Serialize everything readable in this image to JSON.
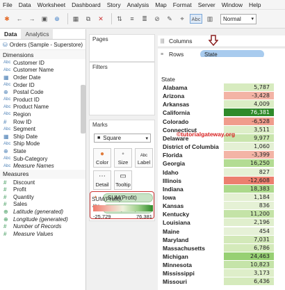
{
  "menu": [
    "File",
    "Data",
    "Worksheet",
    "Dashboard",
    "Story",
    "Analysis",
    "Map",
    "Format",
    "Server",
    "Window",
    "Help"
  ],
  "toolbar": {
    "abc_label": "Abc",
    "fit_value": "Normal"
  },
  "data_pane": {
    "tabs": [
      "Data",
      "Analytics"
    ],
    "datasource": "Orders (Sample - Superstore)",
    "dimensions_title": "Dimensions",
    "dimensions": [
      {
        "type": "Abc",
        "name": "Customer ID"
      },
      {
        "type": "Abc",
        "name": "Customer Name"
      },
      {
        "type": "cal",
        "name": "Order Date"
      },
      {
        "type": "Abc",
        "name": "Order ID"
      },
      {
        "type": "geo",
        "name": "Postal Code"
      },
      {
        "type": "Abc",
        "name": "Product ID"
      },
      {
        "type": "Abc",
        "name": "Product Name"
      },
      {
        "type": "Abc",
        "name": "Region"
      },
      {
        "type": "#",
        "name": "Row ID"
      },
      {
        "type": "Abc",
        "name": "Segment"
      },
      {
        "type": "cal",
        "name": "Ship Date"
      },
      {
        "type": "Abc",
        "name": "Ship Mode"
      },
      {
        "type": "geo",
        "name": "State"
      },
      {
        "type": "Abc",
        "name": "Sub-Category"
      },
      {
        "type": "Abc",
        "name": "Measure Names"
      }
    ],
    "measures_title": "Measures",
    "measures": [
      {
        "type": "#",
        "name": "Discount"
      },
      {
        "type": "#",
        "name": "Profit"
      },
      {
        "type": "#",
        "name": "Quantity"
      },
      {
        "type": "#",
        "name": "Sales"
      },
      {
        "type": "geo",
        "name": "Latitude (generated)"
      },
      {
        "type": "geo",
        "name": "Longitude (generated)"
      },
      {
        "type": "#",
        "name": "Number of Records"
      },
      {
        "type": "#",
        "name": "Measure Values"
      }
    ]
  },
  "pages_title": "Pages",
  "filters_title": "Filters",
  "marks": {
    "title": "Marks",
    "type": "Square",
    "buttons": [
      "Color",
      "Size",
      "Label",
      "Detail",
      "Tooltip"
    ],
    "label_glyph": "Abc\n123",
    "pills": [
      "SUM(Profit)",
      "SUM(Profit)"
    ]
  },
  "legend": {
    "title": "SUM(Profit)",
    "min": "-25,729",
    "max": "76,381"
  },
  "shelves": {
    "columns": "Columns",
    "rows": "Rows",
    "row_pill": "State"
  },
  "table": {
    "header": "State",
    "rows": [
      {
        "state": "Alabama",
        "value": "5,787",
        "color": "#d7ebbf"
      },
      {
        "state": "Arizona",
        "value": "-3,428",
        "color": "#f3b3a5"
      },
      {
        "state": "Arkansas",
        "value": "4,009",
        "color": "#dbedc5"
      },
      {
        "state": "California",
        "value": "76,381",
        "color": "#2f8a2a"
      },
      {
        "state": "Colorado",
        "value": "-6,528",
        "color": "#f09c8c"
      },
      {
        "state": "Connecticut",
        "value": "3,511",
        "color": "#ddeec8"
      },
      {
        "state": "Delaware",
        "value": "9,977",
        "color": "#c9e5ad"
      },
      {
        "state": "District of Columbia",
        "value": "1,060",
        "color": "#e4f0d4"
      },
      {
        "state": "Florida",
        "value": "-3,399",
        "color": "#f3b4a6"
      },
      {
        "state": "Georgia",
        "value": "16,250",
        "color": "#b3dc93"
      },
      {
        "state": "Idaho",
        "value": "827",
        "color": "#e5f1d5"
      },
      {
        "state": "Illinois",
        "value": "-12,608",
        "color": "#ec7f6f"
      },
      {
        "state": "Indiana",
        "value": "18,383",
        "color": "#acd98b"
      },
      {
        "state": "Iowa",
        "value": "1,184",
        "color": "#e4f0d3"
      },
      {
        "state": "Kansas",
        "value": "836",
        "color": "#e5f1d5"
      },
      {
        "state": "Kentucky",
        "value": "11,200",
        "color": "#c4e3a7"
      },
      {
        "state": "Louisiana",
        "value": "2,196",
        "color": "#e0efcd"
      },
      {
        "state": "Maine",
        "value": "454",
        "color": "#e6f1d7"
      },
      {
        "state": "Maryland",
        "value": "7,031",
        "color": "#d3e9b9"
      },
      {
        "state": "Massachusetts",
        "value": "6,786",
        "color": "#d4eaba"
      },
      {
        "state": "Michigan",
        "value": "24,463",
        "color": "#97d073"
      },
      {
        "state": "Minnesota",
        "value": "10,823",
        "color": "#c5e4a9"
      },
      {
        "state": "Mississippi",
        "value": "3,173",
        "color": "#deeec9"
      },
      {
        "state": "Missouri",
        "value": "6,436",
        "color": "#d5eabc"
      }
    ]
  },
  "watermark": "©tutorialgateway.org"
}
